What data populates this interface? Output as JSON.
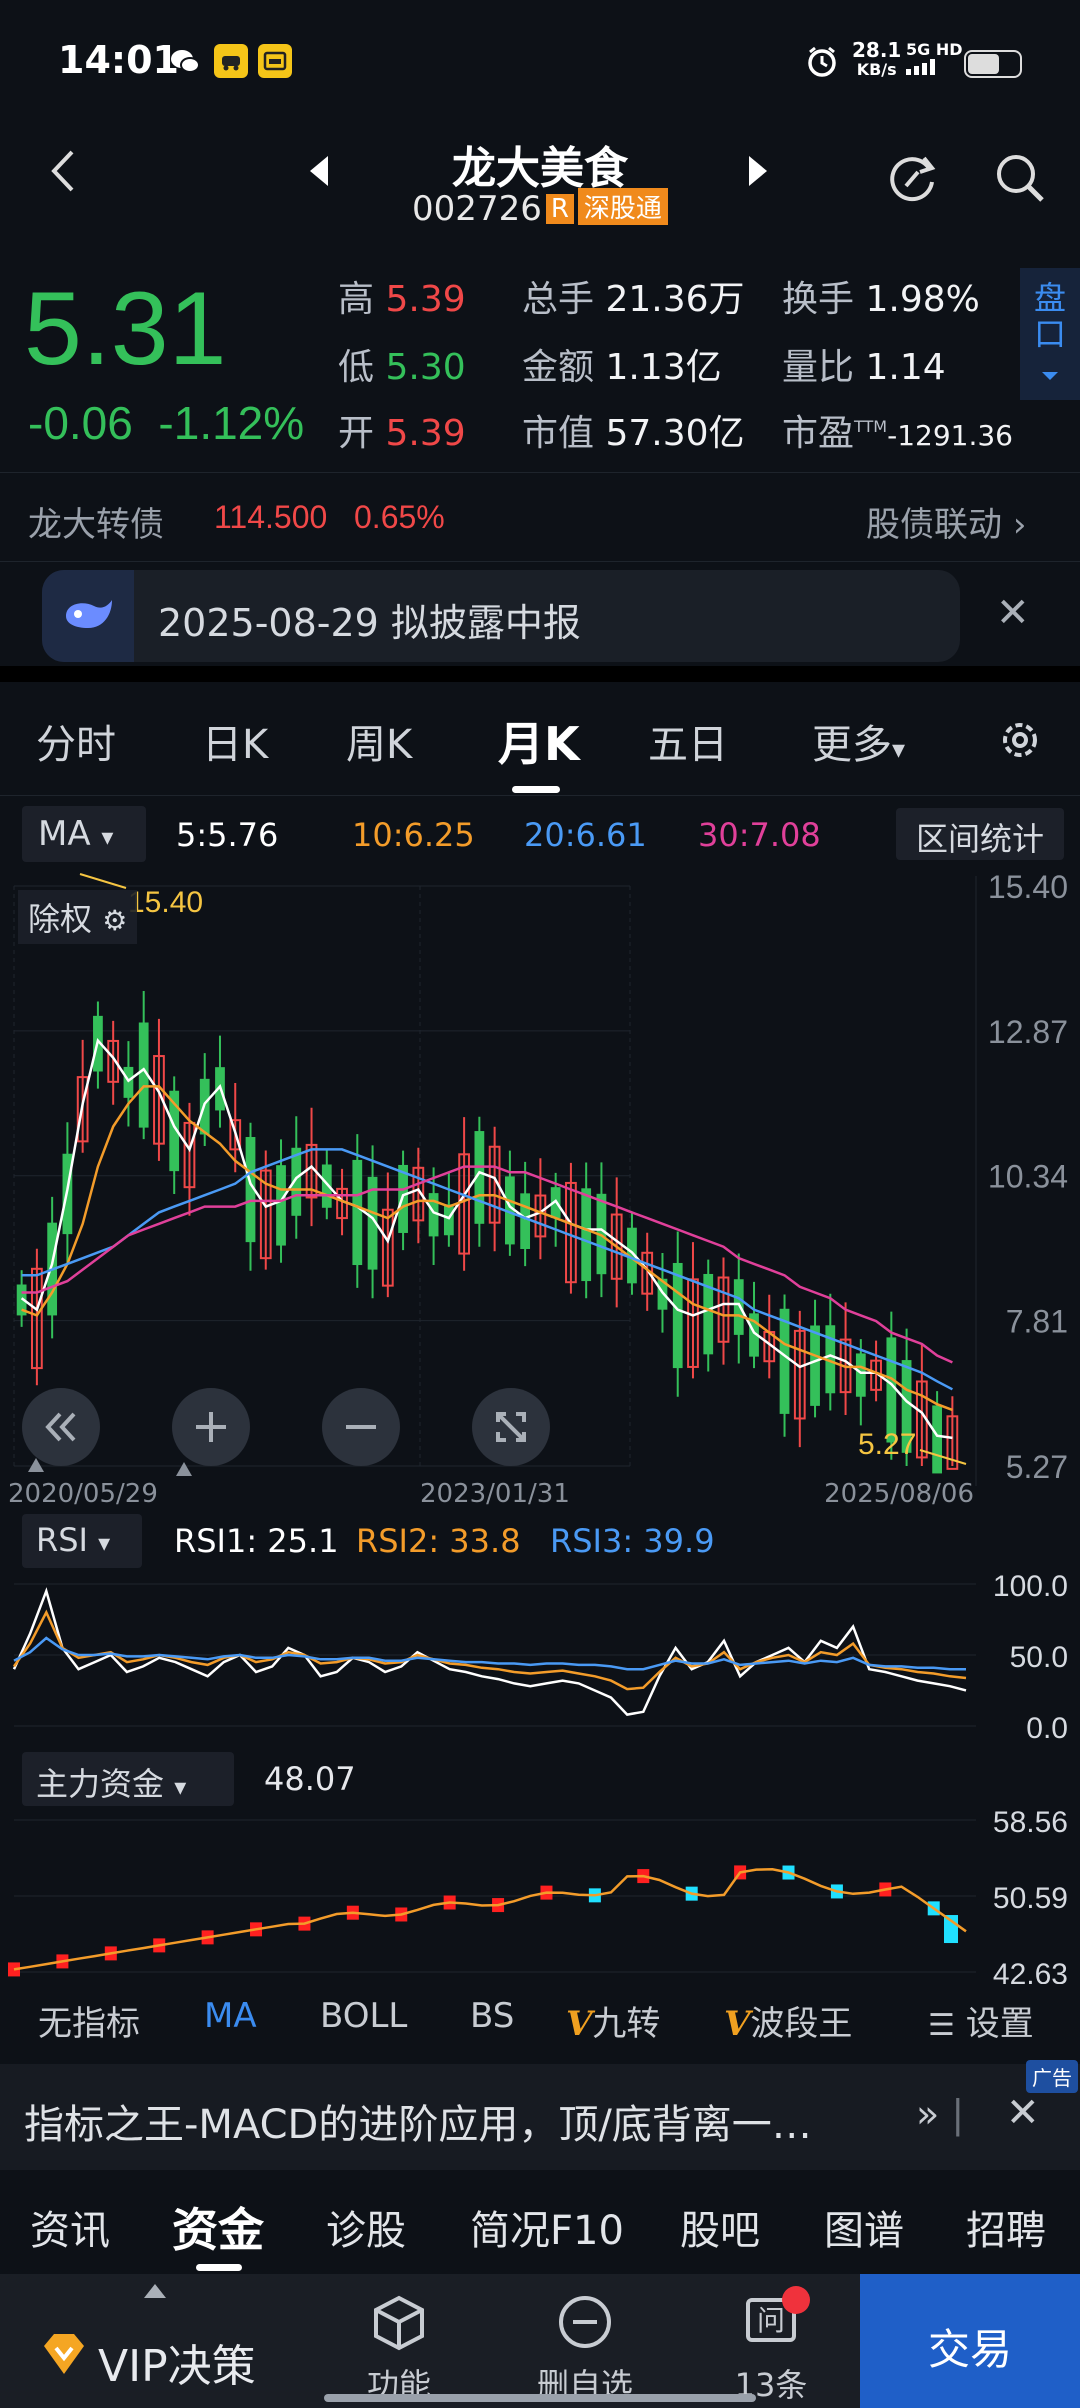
{
  "status_bar": {
    "time": "14:01",
    "speed_value": "28.1",
    "speed_unit": "KB/s",
    "network": "5G HD",
    "battery_level": 0.62
  },
  "header": {
    "stock_name": "龙大美食",
    "stock_code": "002726",
    "tag_r": "R",
    "tag_connect": "深股通"
  },
  "quote": {
    "price": "5.31",
    "change": "-0.06",
    "change_pct": "-1.12%",
    "high_label": "高",
    "high": "5.39",
    "low_label": "低",
    "low": "5.30",
    "open_label": "开",
    "open": "5.39",
    "volume_label": "总手",
    "volume": "21.36万",
    "amount_label": "金额",
    "amount": "1.13亿",
    "mktcap_label": "市值",
    "mktcap": "57.30亿",
    "turnover_label": "换手",
    "turnover": "1.98%",
    "volratio_label": "量比",
    "volratio": "1.14",
    "pe_label": "市盈",
    "pe_sup": "TTM",
    "pe": "-1291.36",
    "pankou": "盘口"
  },
  "bond": {
    "name": "龙大转债",
    "price": "114.500",
    "pct": "0.65%",
    "link": "股债联动"
  },
  "notice": {
    "text": "2025-08-29 拟披露中报"
  },
  "kline_tabs": [
    "分时",
    "日K",
    "周K",
    "月K",
    "五日",
    "更多"
  ],
  "ma_row": {
    "selector": "MA",
    "ma5": "5:5.76",
    "ma10": "10:6.25",
    "ma20": "20:6.61",
    "ma30": "30:7.08",
    "range_stats": "区间统计"
  },
  "colors": {
    "ma5": "#ffffff",
    "ma10": "#f39c2a",
    "ma20": "#4a9af5",
    "ma30": "#e0409a",
    "up": "#f04848",
    "down": "#34c05a"
  },
  "chart_data": [
    {
      "type": "candlestick",
      "title": "月K",
      "ex_rights_label": "除权",
      "y_ticks": [
        "15.40",
        "12.87",
        "10.34",
        "7.81",
        "5.27"
      ],
      "ylim": [
        5.27,
        15.4
      ],
      "x_labels": [
        "2020/05/29",
        "2023/01/31",
        "2025/08/06"
      ],
      "high_mark": "15.40",
      "low_mark": "5.27",
      "series": [
        {
          "name": "5",
          "values": [
            8.2,
            8.0,
            8.8,
            10.1,
            11.6,
            12.7,
            12.4,
            12.0,
            12.2,
            11.8,
            11.2,
            10.8,
            11.6,
            11.9,
            11.1,
            10.2,
            9.8,
            9.9,
            10.3,
            10.5,
            10.2,
            9.9,
            9.8,
            9.6,
            9.2,
            10.0,
            10.1,
            9.7,
            9.6,
            10.0,
            10.4,
            10.3,
            9.8,
            9.6,
            9.7,
            9.9,
            9.5,
            9.4,
            9.4,
            9.2,
            9.0,
            8.7,
            8.3,
            8.0,
            7.9,
            8.0,
            8.1,
            8.1,
            7.6,
            7.4,
            7.2,
            7.0,
            7.1,
            7.2,
            7.1,
            6.9,
            6.9,
            6.7,
            6.4,
            6.2,
            5.8,
            5.76
          ]
        },
        {
          "name": "10",
          "values": [
            8.0,
            7.9,
            8.3,
            8.8,
            9.5,
            10.5,
            11.2,
            11.6,
            11.9,
            11.9,
            11.6,
            11.3,
            11.1,
            10.9,
            10.6,
            10.4,
            10.2,
            10.1,
            10.1,
            10.1,
            10.0,
            9.9,
            9.8,
            9.7,
            9.6,
            9.8,
            9.9,
            9.9,
            9.8,
            9.9,
            10.0,
            10.0,
            9.9,
            9.8,
            9.7,
            9.6,
            9.5,
            9.4,
            9.3,
            9.1,
            8.9,
            8.7,
            8.5,
            8.3,
            8.1,
            8.0,
            7.9,
            7.9,
            7.8,
            7.6,
            7.4,
            7.3,
            7.2,
            7.1,
            7.0,
            7.0,
            6.9,
            6.8,
            6.6,
            6.5,
            6.35,
            6.25
          ]
        },
        {
          "name": "20",
          "values": [
            8.6,
            8.6,
            8.7,
            8.8,
            8.9,
            9.0,
            9.1,
            9.3,
            9.5,
            9.7,
            9.8,
            9.9,
            10.0,
            10.1,
            10.2,
            10.4,
            10.5,
            10.6,
            10.7,
            10.8,
            10.8,
            10.8,
            10.7,
            10.6,
            10.5,
            10.4,
            10.3,
            10.2,
            10.1,
            10.0,
            9.9,
            9.8,
            9.7,
            9.6,
            9.5,
            9.4,
            9.3,
            9.2,
            9.1,
            9.0,
            8.9,
            8.8,
            8.7,
            8.6,
            8.5,
            8.4,
            8.3,
            8.2,
            8.0,
            7.9,
            7.8,
            7.7,
            7.6,
            7.5,
            7.4,
            7.3,
            7.2,
            7.1,
            7.0,
            6.9,
            6.75,
            6.61
          ]
        },
        {
          "name": "30",
          "values": [
            8.3,
            8.3,
            8.4,
            8.5,
            8.7,
            8.9,
            9.1,
            9.3,
            9.4,
            9.5,
            9.6,
            9.7,
            9.8,
            9.8,
            9.8,
            9.9,
            9.9,
            9.9,
            10.0,
            10.0,
            10.0,
            10.0,
            10.0,
            10.1,
            10.1,
            10.1,
            10.2,
            10.3,
            10.4,
            10.5,
            10.5,
            10.5,
            10.4,
            10.4,
            10.3,
            10.2,
            10.1,
            10.0,
            9.9,
            9.8,
            9.7,
            9.6,
            9.5,
            9.4,
            9.3,
            9.2,
            9.1,
            8.9,
            8.8,
            8.7,
            8.6,
            8.4,
            8.3,
            8.2,
            8.0,
            7.9,
            7.8,
            7.6,
            7.5,
            7.4,
            7.2,
            7.08
          ]
        }
      ]
    },
    {
      "type": "line",
      "title": "RSI",
      "y_ticks": [
        "100.0",
        "50.0",
        "0.0"
      ],
      "ylim": [
        0,
        100
      ],
      "series": [
        {
          "name": "RSI1: 25.1",
          "values": [
            40,
            65,
            95,
            55,
            40,
            45,
            50,
            38,
            42,
            48,
            45,
            40,
            35,
            45,
            50,
            38,
            42,
            55,
            50,
            35,
            38,
            48,
            45,
            38,
            42,
            52,
            46,
            40,
            38,
            35,
            33,
            30,
            28,
            30,
            32,
            30,
            25,
            20,
            8,
            10,
            35,
            55,
            40,
            45,
            60,
            35,
            45,
            50,
            55,
            45,
            60,
            55,
            70,
            40,
            38,
            35,
            32,
            30,
            28,
            25.1
          ]
        },
        {
          "name": "RSI2: 33.8",
          "values": [
            42,
            58,
            80,
            55,
            48,
            50,
            52,
            45,
            47,
            50,
            48,
            45,
            43,
            48,
            50,
            45,
            47,
            52,
            50,
            44,
            45,
            48,
            47,
            44,
            45,
            50,
            47,
            44,
            43,
            41,
            40,
            38,
            37,
            38,
            39,
            37,
            35,
            32,
            26,
            27,
            38,
            48,
            42,
            44,
            52,
            40,
            45,
            48,
            50,
            45,
            52,
            50,
            58,
            43,
            41,
            40,
            38,
            37,
            35,
            33.8
          ]
        },
        {
          "name": "RSI3: 39.9",
          "values": [
            46,
            52,
            62,
            54,
            50,
            50,
            51,
            49,
            49,
            50,
            49,
            48,
            47,
            49,
            50,
            48,
            48,
            50,
            49,
            47,
            47,
            48,
            48,
            46,
            46,
            48,
            47,
            46,
            45,
            45,
            44,
            44,
            43,
            44,
            44,
            43,
            43,
            42,
            40,
            40,
            43,
            46,
            44,
            44,
            47,
            43,
            44,
            45,
            46,
            44,
            46,
            45,
            48,
            43,
            42,
            42,
            41,
            41,
            40,
            39.9
          ]
        }
      ]
    },
    {
      "type": "line",
      "title": "主力资金",
      "value": "48.07",
      "y_ticks": [
        "58.56",
        "50.59",
        "42.63"
      ],
      "ylim": [
        42.63,
        58.56
      ]
    }
  ],
  "chart_labels": {
    "rsi_selector": "RSI",
    "capital_selector": "主力资金"
  },
  "indicator_bar": [
    "无指标",
    "MA",
    "BOLL",
    "BS",
    "九转",
    "波段王",
    "设置"
  ],
  "ad": {
    "text": "指标之王-MACD的进阶应用，顶/底背离一…",
    "badge": "广告"
  },
  "bottom_tabs": [
    "资讯",
    "资金",
    "诊股",
    "简况F10",
    "股吧",
    "图谱",
    "招聘"
  ],
  "actions": {
    "vip": "VIP决策",
    "func": "功能",
    "remove": "删自选",
    "ask": "13条",
    "trade": "交易"
  }
}
